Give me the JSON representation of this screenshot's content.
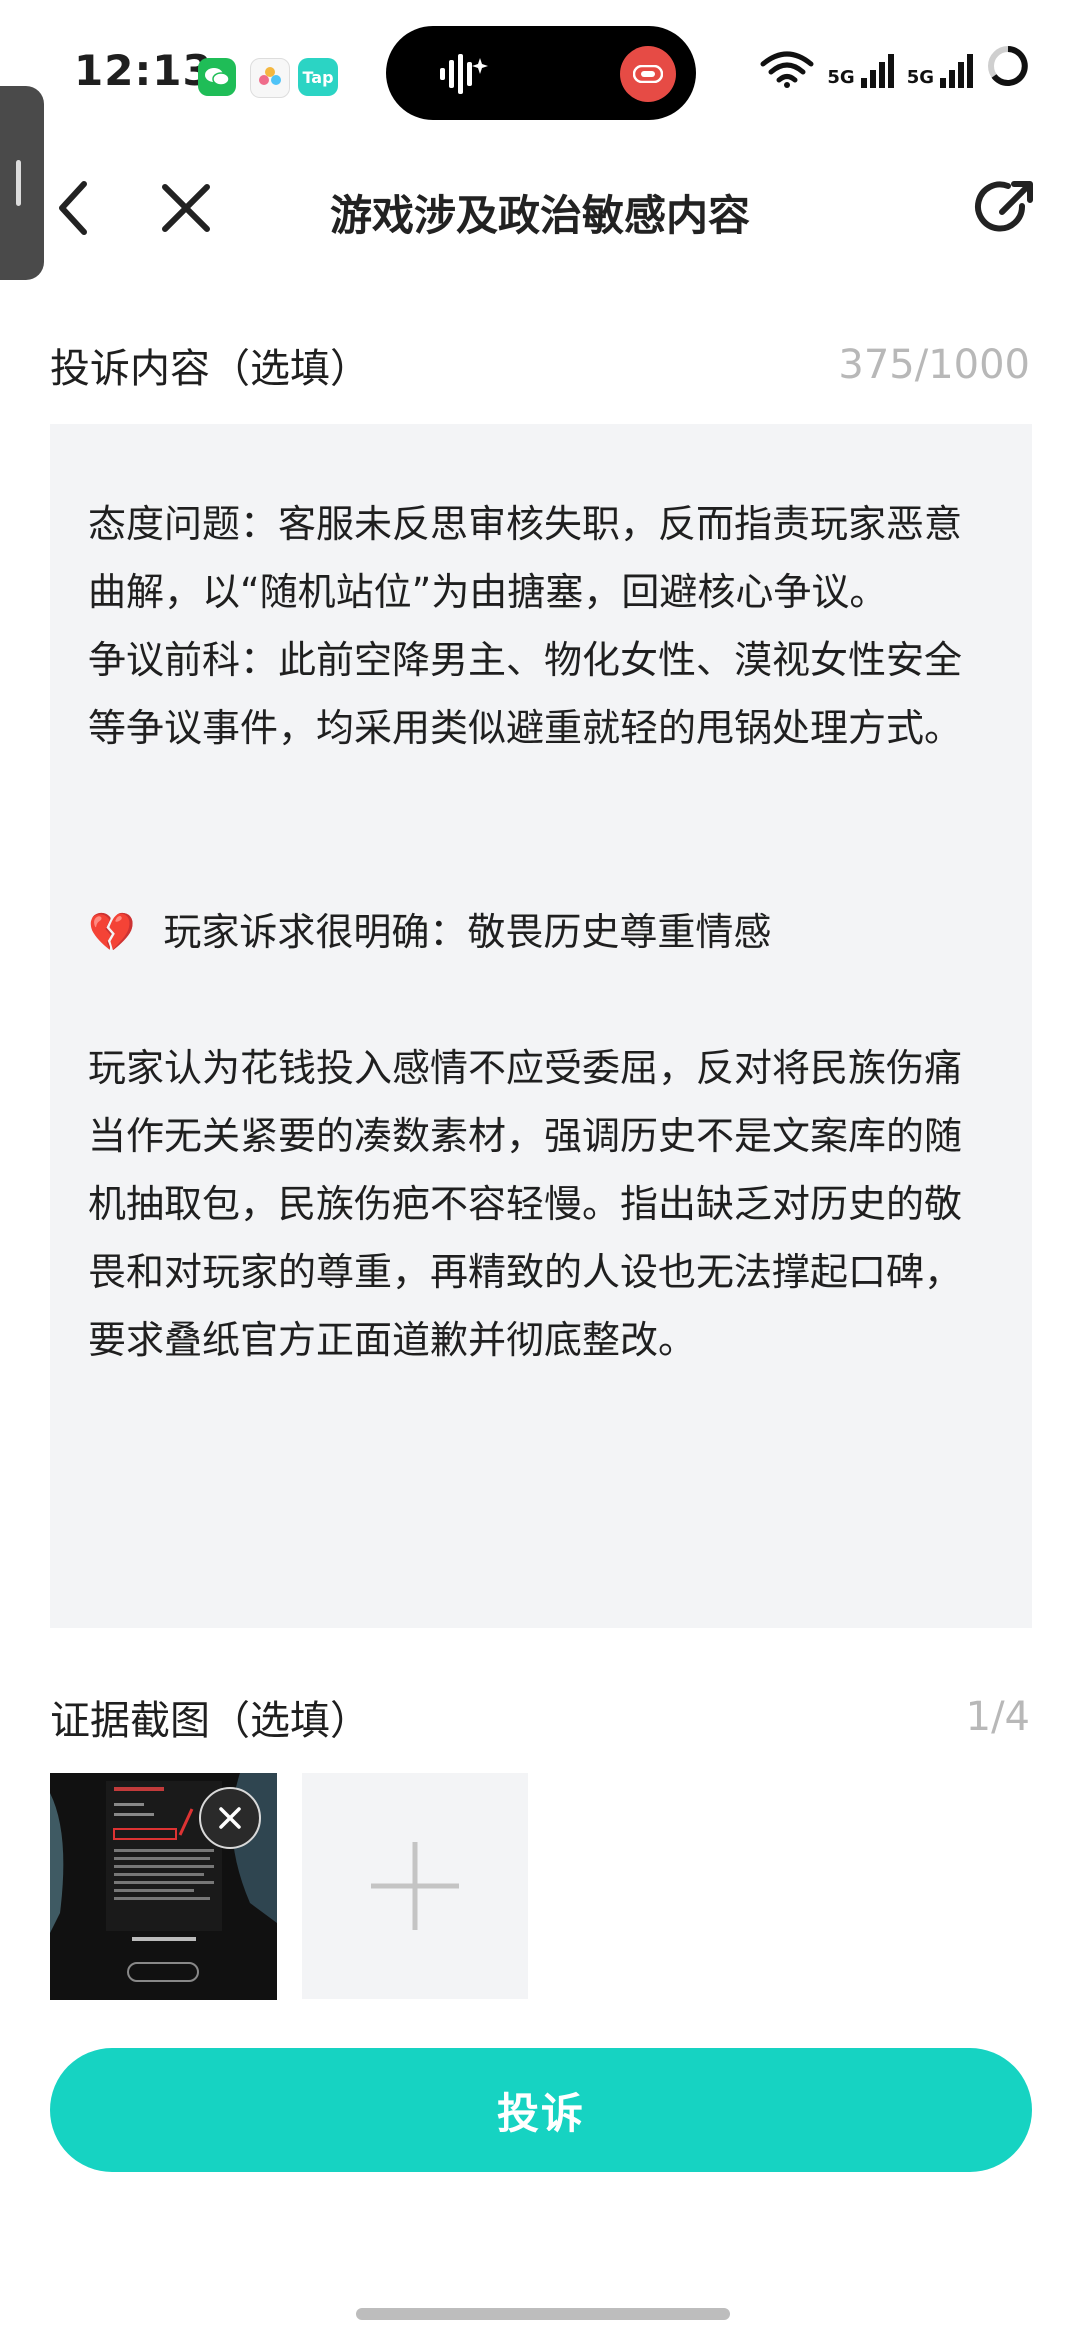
{
  "status_bar": {
    "time": "12:13",
    "tap_label": "Tap",
    "net1": "5G",
    "net2": "5G",
    "wifi_sub": "6"
  },
  "nav": {
    "title": "游戏涉及政治敏感内容",
    "back_icon": "chevron-left-icon",
    "close_icon": "close-icon",
    "share_icon": "share-icon"
  },
  "complaint": {
    "label": "投诉内容（选填）",
    "counter": "375/1000",
    "paragraphs": [
      "态度问题：客服未反思审核失职，反而指责玩家恶意曲解，以“随机站位”为由搪塞，回避核心争议。",
      "争议前科：此前空降男主、物化女性、漠视女性安全等争议事件，均采用类似避重就轻的甩锅处理方式。",
      "玩家诉求很明确：敬畏历史尊重情感",
      "玩家认为花钱投入感情不应受委屈，反对将民族伤痛当作无关紧要的凑数素材，强调历史不是文案库的随机抽取包，民族伤疤不容轻慢。指出缺乏对历史的敬畏和对玩家的尊重，再精致的人设也无法撑起口碑，要求叠纸官方正面道歉并彻底整改。"
    ],
    "emoji": "💔"
  },
  "evidence": {
    "label": "证据截图（选填）",
    "counter": "1/4"
  },
  "submit_label": "投诉",
  "colors": {
    "accent": "#16d3c2",
    "box_bg": "#f3f4f6",
    "muted": "#b8b8b8"
  }
}
